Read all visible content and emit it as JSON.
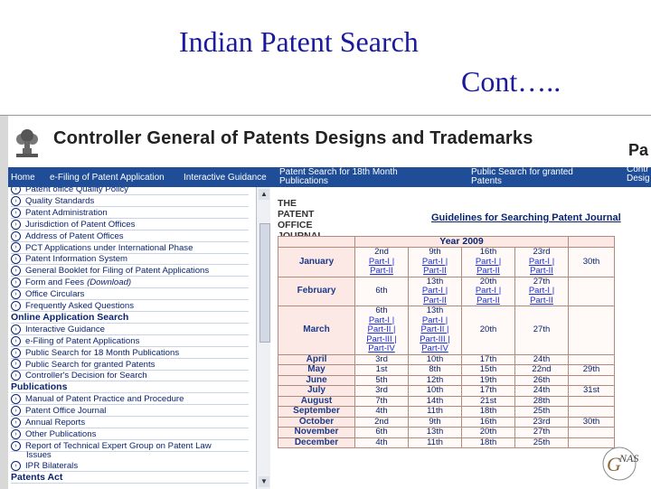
{
  "slide": {
    "title_line1": "Indian Patent Search",
    "title_line2": "Cont….."
  },
  "header": {
    "title": "Controller General of Patents Designs and Trademarks",
    "right_fragment": "Pa"
  },
  "nav": {
    "home": "Home",
    "efiling": "e-Filing of Patent Application",
    "guidance": "Interactive Guidance",
    "patent_search_l1": "Patent Search for 18th Month",
    "patent_search_l2": "Publications",
    "public_search_l1": "Public Search for granted",
    "public_search_l2": "Patents",
    "right_l1": "Contr",
    "right_l2": "Desig"
  },
  "sidebar": {
    "top_partial": "Patent office Quality Policy",
    "group1": [
      "Quality Standards",
      "Patent Administration",
      "Jurisdiction of Patent Offices",
      "Address of Patent Offices",
      "PCT Applications under International Phase",
      "Patent Information System",
      "General Booklet for Filing of Patent Applications",
      "Form and Fees",
      "Office Circulars",
      "Frequently Asked Questions"
    ],
    "form_fees_suffix": "(Download)",
    "section_online": "Online Application Search",
    "group2": [
      "Interactive Guidance",
      "e-Filing of Patent Applications",
      "Public Search for 18 Month Publications",
      "Public Search for granted Patents",
      "Controller's Decision for Search"
    ],
    "section_publications": "Publications",
    "group3": [
      "Manual of Patent Practice and Procedure",
      "Patent Office Journal",
      "Annual Reports",
      "Other Publications"
    ],
    "report_l1": "Report of Technical Expert Group on Patent Law",
    "report_l2": "Issues",
    "ipr": "IPR Bilaterals",
    "section_patents_act": "Patents Act"
  },
  "content": {
    "the_journal": [
      "THE",
      "PATENT",
      "OFFICE",
      "JOURNAL"
    ],
    "guidelines_title": "Guidelines for Searching Patent Journal",
    "year_label": "Year 2009",
    "rows": [
      {
        "month": "January",
        "cells": [
          [
            "2nd",
            "Part-I |",
            "Part-II"
          ],
          [
            "9th",
            "Part-I |",
            "Part-II"
          ],
          [
            "16th",
            "Part-I |",
            "Part-II"
          ],
          [
            "23rd",
            "Part-I |",
            "Part-II"
          ],
          [
            "30th"
          ]
        ]
      },
      {
        "month": "February",
        "cells": [
          [
            "6th"
          ],
          [
            "13th",
            "Part-I |",
            "Part-II"
          ],
          [
            "20th",
            "Part-I |",
            "Part-II"
          ],
          [
            "27th",
            "Part-I |",
            "Part-II"
          ],
          [
            ""
          ]
        ]
      },
      {
        "month": "March",
        "cells": [
          [
            "6th",
            "Part-I |",
            "Part-II |",
            "Part-III |",
            "Part-IV"
          ],
          [
            "13th",
            "Part-I |",
            "Part-II |",
            "Part-III |",
            "Part-IV"
          ],
          [
            "20th"
          ],
          [
            "27th"
          ],
          [
            ""
          ]
        ]
      },
      {
        "month": "April",
        "cells": [
          [
            "3rd"
          ],
          [
            "10th"
          ],
          [
            "17th"
          ],
          [
            "24th"
          ],
          [
            ""
          ]
        ]
      },
      {
        "month": "May",
        "cells": [
          [
            "1st"
          ],
          [
            "8th"
          ],
          [
            "15th"
          ],
          [
            "22nd"
          ],
          [
            "29th"
          ]
        ]
      },
      {
        "month": "June",
        "cells": [
          [
            "5th"
          ],
          [
            "12th"
          ],
          [
            "19th"
          ],
          [
            "26th"
          ],
          [
            ""
          ]
        ]
      },
      {
        "month": "July",
        "cells": [
          [
            "3rd"
          ],
          [
            "10th"
          ],
          [
            "17th"
          ],
          [
            "24th"
          ],
          [
            "31st"
          ]
        ]
      },
      {
        "month": "August",
        "cells": [
          [
            "7th"
          ],
          [
            "14th"
          ],
          [
            "21st"
          ],
          [
            "28th"
          ],
          [
            ""
          ]
        ]
      },
      {
        "month": "September",
        "cells": [
          [
            "4th"
          ],
          [
            "11th"
          ],
          [
            "18th"
          ],
          [
            "25th"
          ],
          [
            ""
          ]
        ]
      },
      {
        "month": "October",
        "cells": [
          [
            "2nd"
          ],
          [
            "9th"
          ],
          [
            "16th"
          ],
          [
            "23rd"
          ],
          [
            "30th"
          ]
        ]
      },
      {
        "month": "November",
        "cells": [
          [
            "6th"
          ],
          [
            "13th"
          ],
          [
            "20th"
          ],
          [
            "27th"
          ],
          [
            ""
          ]
        ]
      },
      {
        "month": "December",
        "cells": [
          [
            "4th"
          ],
          [
            "11th"
          ],
          [
            "18th"
          ],
          [
            "25th"
          ],
          [
            ""
          ]
        ]
      }
    ]
  },
  "logo_text": "NAS",
  "colors": {
    "title": "#1a1a9a",
    "navbar": "#1f4d97",
    "link": "#1a2fd6",
    "sidebar_text": "#0b2470",
    "table_header_bg": "#fce8e4"
  }
}
